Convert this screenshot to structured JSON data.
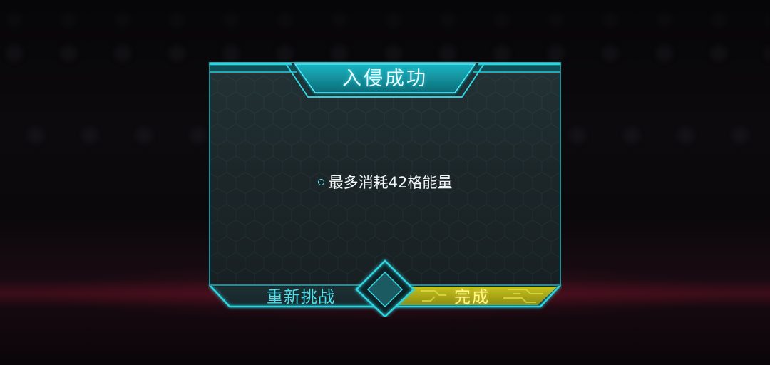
{
  "dialog": {
    "title": "入侵成功",
    "message": "最多消耗42格能量",
    "retry_label": "重新挑战",
    "done_label": "完成"
  },
  "colors": {
    "frame_cyan": "#2fd3df",
    "panel_bg": "#1e2b2e",
    "done_yellow": "#b9b51c",
    "retry_text": "#4fe0ee",
    "done_text": "#fff58a"
  }
}
